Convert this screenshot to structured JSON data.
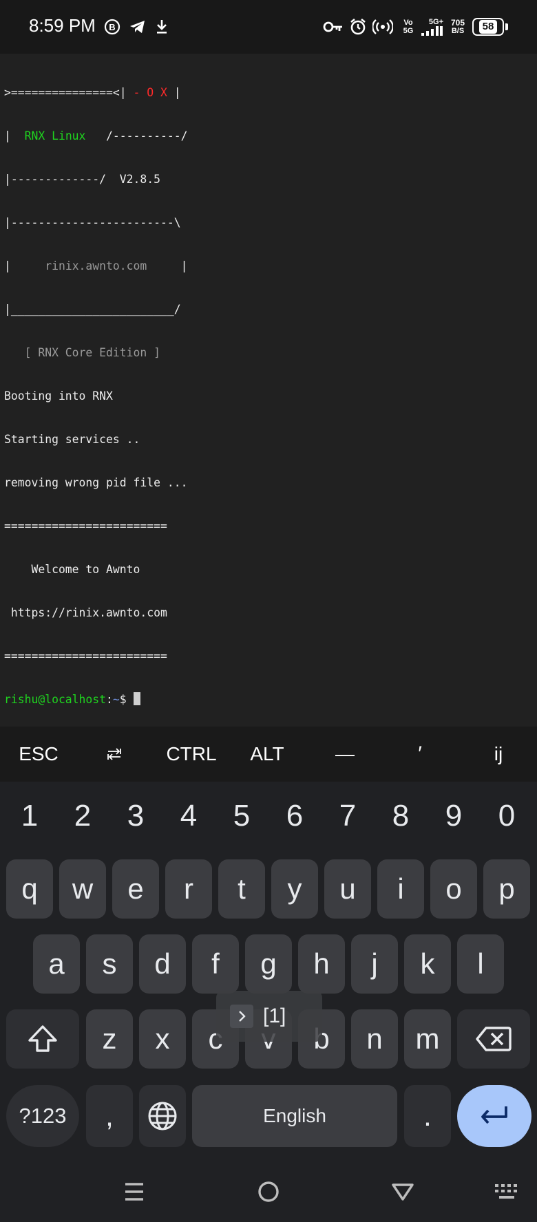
{
  "status_bar": {
    "time": "8:59 PM",
    "network_label_top": "Vo",
    "network_label_bottom": "5G",
    "signal_label": "5G+",
    "speed_value": "705",
    "speed_unit": "B/S",
    "battery": "58",
    "icons": [
      "b-circle-icon",
      "telegram-icon",
      "download-icon",
      "vpn-key-icon",
      "alarm-icon",
      "hotspot-icon",
      "signal-icon"
    ]
  },
  "terminal": {
    "banner": {
      "top_left": ">===============<| ",
      "window_controls": "- O X",
      "top_right": " |",
      "line2_prefix": "|  ",
      "distro": "RNX Linux",
      "line2_suffix": "   /----------/",
      "line3": "|-------------/  V2.8.5",
      "line4": "|------------------------\\",
      "line5_prefix": "|     ",
      "website": "rinix.awnto.com",
      "line5_suffix": "     |",
      "line6": "|________________________/",
      "edition": "   [ RNX Core Edition ]"
    },
    "output": [
      "Booting into RNX",
      "Starting services ..",
      "removing wrong pid file ...",
      "========================",
      "    Welcome to Awnto",
      " https://rinix.awnto.com",
      "========================"
    ],
    "prompt_user": "rishu@localhost",
    "prompt_sep": ":",
    "prompt_path": "~",
    "prompt_symbol": "$ "
  },
  "extra_keys": [
    "ESC",
    "⭾",
    "CTRL",
    "ALT",
    "—",
    "′",
    "ij"
  ],
  "keyboard": {
    "numbers": [
      "1",
      "2",
      "3",
      "4",
      "5",
      "6",
      "7",
      "8",
      "9",
      "0"
    ],
    "row1": [
      "q",
      "w",
      "e",
      "r",
      "t",
      "y",
      "u",
      "i",
      "o",
      "p"
    ],
    "row2": [
      "a",
      "s",
      "d",
      "f",
      "g",
      "h",
      "j",
      "k",
      "l"
    ],
    "row3": [
      "z",
      "x",
      "c",
      "v",
      "b",
      "n",
      "m"
    ],
    "symbols_key": "?123",
    "comma_key": ",",
    "space_label": "English",
    "period_key": ".",
    "suggestion_popup": "[1]",
    "accent_color": "#a8c7fa"
  },
  "nav_bar": {
    "icons": [
      "menu-icon",
      "home-icon",
      "back-icon",
      "keyboard-icon"
    ]
  }
}
